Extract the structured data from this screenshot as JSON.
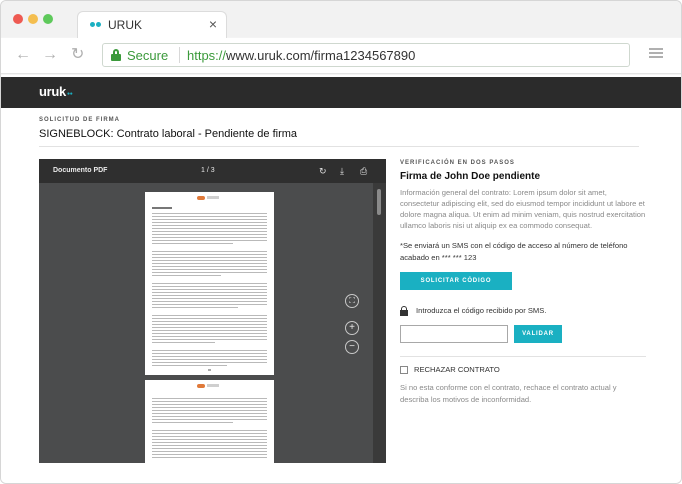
{
  "browser": {
    "tab_title": "URUK",
    "tab_close": "×",
    "secure_label": "Secure",
    "url_scheme": "https://",
    "url_rest": "www.uruk.com/firma1234567890",
    "nav_back": "←",
    "nav_forward": "→",
    "nav_reload": "↻"
  },
  "app": {
    "brand": "uruk",
    "brand_dots": "●●"
  },
  "page": {
    "kicker": "Solicitud de firma",
    "title": "SIGNEBLOCK: Contrato laboral - Pendiente de firma"
  },
  "pdf": {
    "title": "Documento PDF",
    "page_indicator": "1 / 3",
    "rotate_glyph": "↻",
    "download_glyph": "⤓",
    "print_glyph": "⎙",
    "zoom_fit_glyph": "⛶",
    "zoom_in_glyph": "+",
    "zoom_out_glyph": "−"
  },
  "verification": {
    "kicker": "Verificación en dos pasos",
    "title": "Firma de John Doe pendiente",
    "description": "Información general del contrato: Lorem ipsum dolor sit amet, consectetur adipiscing elit, sed do eiusmod tempor incididunt ut labore et dolore magna aliqua. Ut enim ad minim veniam, quis nostrud exercitation ullamco laboris nisi ut aliquip ex ea commodo consequat.",
    "sms_notice": "*Se enviará un SMS con el código de acceso al número de teléfono acabado en *** *** 123",
    "request_code_label": "Solicitar código",
    "code_hint": "Introduzca el código recibido por SMS.",
    "code_value": "",
    "validate_label": "Validar"
  },
  "reject": {
    "label": "Rechazar contrato",
    "description": "Si no esta conforme con el contrato, rechace el contrato actual y describa los motivos de inconformidad."
  },
  "colors": {
    "accent": "#1ab0c2",
    "secure": "#3b9a3b",
    "header_bg": "#2b2b2b"
  }
}
